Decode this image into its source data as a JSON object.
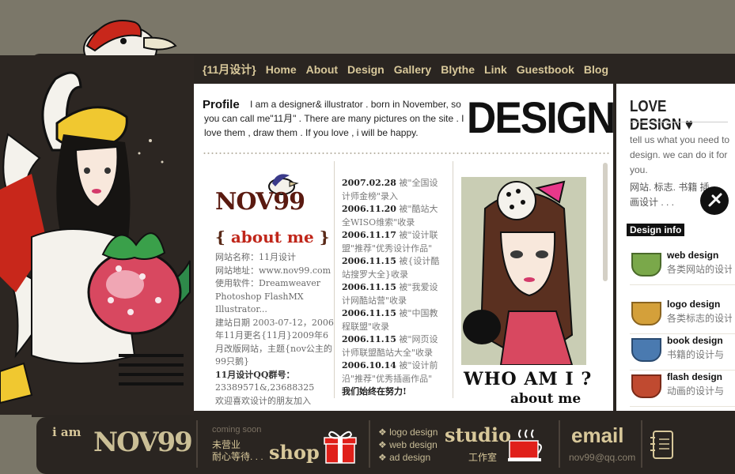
{
  "nav": {
    "brand": "{11月设计}",
    "items": [
      "Home",
      "About",
      "Design",
      "Gallery",
      "Blythe",
      "Link",
      "Guestbook",
      "Blog"
    ]
  },
  "profile": {
    "title": "Profile",
    "text": "I am a designer& illustrator . born in November, so you can call me\"11月\" . There are many pictures on the site . I love them , draw them . If you love , i will be happy.",
    "design_word": "DESIGN"
  },
  "about": {
    "logo": "NOV99",
    "heading_open": "{",
    "heading": "about me",
    "heading_close": "}",
    "info": [
      {
        "k": "网站名称：",
        "v": "11月设计"
      },
      {
        "k": "网站地址：",
        "v": "www.nov99.com"
      },
      {
        "k": "使用软件：",
        "v": "Dreamweaver Photoshop FlashMX Illustrator..."
      },
      {
        "k": "",
        "v": "建站日期 2003-07-12，2006年11月更名{11月}2009年6月改版网站，主题{nov公主的99只鹅}"
      },
      {
        "k": "11月设计QQ群号：",
        "v": "23389571&,23688325"
      },
      {
        "k": "",
        "v": "欢迎喜欢设计的朋友加入"
      }
    ]
  },
  "news": {
    "items": [
      {
        "date": "2007.02.28",
        "text": "被\"全国设计师金榜\"录入"
      },
      {
        "date": "2006.11.20",
        "text": "被\"酷站大全WISO维索\"收录"
      },
      {
        "date": "2006.11.17",
        "text": "被\"设计联盟\"推荐\"优秀设计作品\""
      },
      {
        "date": "2006.11.15",
        "text": "被{设计酷站搜罗大全}收录"
      },
      {
        "date": "2006.11.15",
        "text": "被\"我爱设计网酷站营\"收录"
      },
      {
        "date": "2006.11.15",
        "text": "被\"中国教程联盟\"收录"
      },
      {
        "date": "2006.11.15",
        "text": "被\"网页设计师联盟酷站大全\"收录"
      },
      {
        "date": "2006.10.14",
        "text": "被\"设计前沿\"推荐\"优秀插画作品\""
      }
    ],
    "closing": "我们始终在努力!"
  },
  "who": {
    "title": "WHO AM I ?",
    "subtitle": "about me"
  },
  "right": {
    "title": "LOVE DESIGN ♥",
    "tell": "tell us what you need to design.  we can do it for you.",
    "tags": "网站. 标志. 书籍 插画设计 . . .",
    "info_label": "Design info",
    "services": [
      {
        "title": "web design",
        "sub": "各类网站的设计与制作...",
        "color": "#7aa84a"
      },
      {
        "title": "logo design",
        "sub": "各类标志的设计",
        "color": "#d4a03a"
      },
      {
        "title": "book design",
        "sub": "书籍的设计与",
        "color": "#4a7ab0"
      },
      {
        "title": "flash design",
        "sub": "动画的设计与",
        "color": "#c04a30"
      }
    ]
  },
  "footer": {
    "iam": "i am",
    "logo": "NOV99",
    "coming": "coming soon",
    "cn1": "未营业",
    "cn2": "耐心等待. . .",
    "shop": "shop",
    "links": [
      "logo design",
      "web design",
      "ad design"
    ],
    "studio": "studio",
    "studio_cn": "工作室",
    "email": "email",
    "email_addr": "nov99@qq.com"
  }
}
